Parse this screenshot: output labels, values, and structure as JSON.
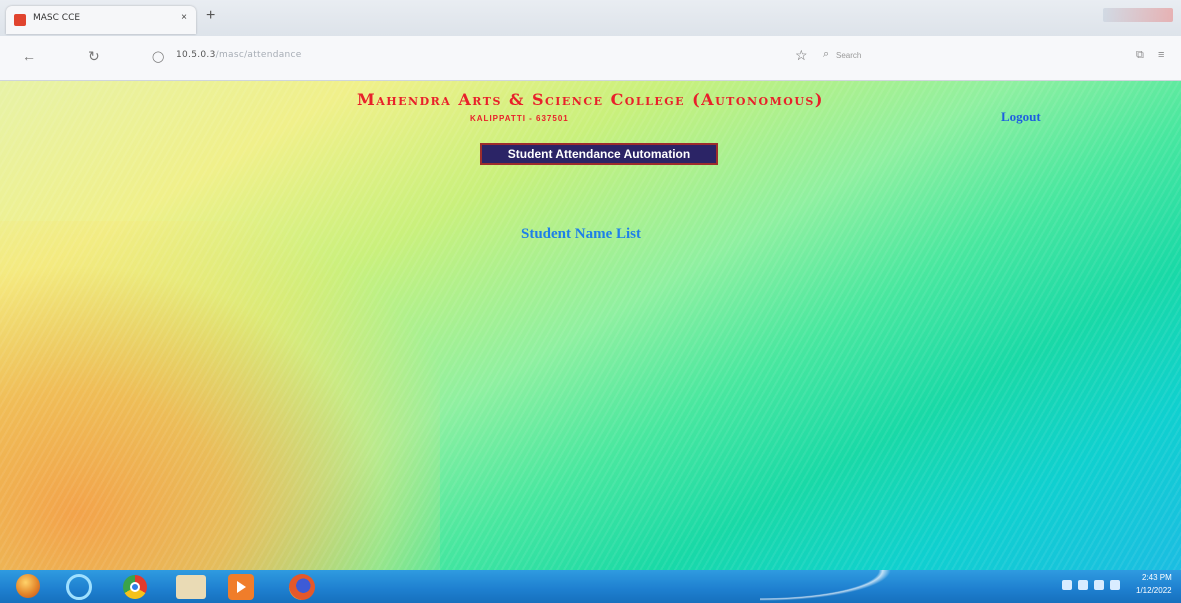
{
  "browser": {
    "tab_title": "MASC CCE",
    "tab_close": "×",
    "new_tab": "+",
    "back": "←",
    "reload": "↻",
    "url_host": "10.5.0.3",
    "url_path": "/masc/attendance",
    "search_placeholder": "Search"
  },
  "page": {
    "college_name": "Mahendra Arts & Science College (Autonomous)",
    "college_place": "KALIPPATTI - 637501",
    "logout": "Logout",
    "app_title": "Student Attendance Automation",
    "list_heading": "Student Name List"
  },
  "taskbar": {
    "clock_time": "2:43 PM",
    "clock_date": "1/12/2022"
  },
  "colors": {
    "college_red": "#e8202a",
    "heading_blue": "#1e7fe8",
    "button_bg": "#2b2466",
    "taskbar_blue": "#1e7fcf"
  }
}
